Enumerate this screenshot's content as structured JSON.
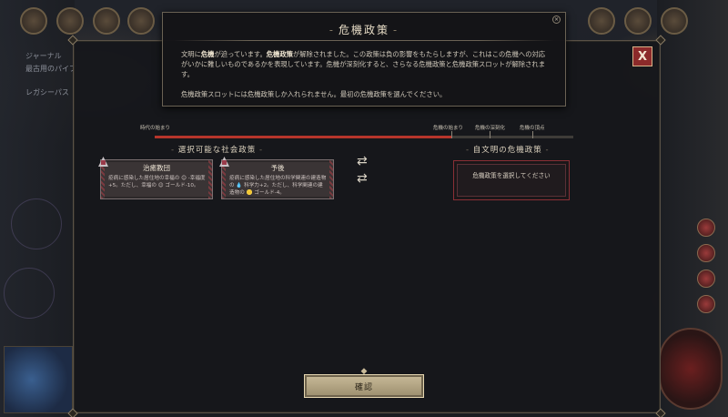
{
  "header": {
    "title": "危機政策",
    "body_line1_parts": [
      "文明に",
      "危機",
      "が迫っています。",
      "危機政策",
      "が解除されました。この政策は負の影響をもたらしますが、これはこの危機への対応がいかに難しいものであるかを表現しています。危機が深刻化すると、さらなる危機政策と危機政策スロットが解除されます。"
    ],
    "body_line2": "危機政策スロットには危機政策しか入れられません。最初の危機政策を選んでください。"
  },
  "timeline": {
    "start_label": "時代の始まり",
    "crisis_start_label": "危機の始まり",
    "crisis_deepening_label": "危機の深刻化",
    "crisis_peak_label": "危機の頂点",
    "progress_fraction": 0.71
  },
  "available": {
    "title": "選択可能な社会政策",
    "cards": [
      {
        "title": "治癒教団",
        "desc": "疫病に感染した居住地の幸福の 😊 -幸福度+5。ただし、幸福の 😊 ゴールド-10。"
      },
      {
        "title": "予後",
        "desc": "疫病に感染した居住地の科学関連の建造物の 💧 科学力+2。ただし、科学関連の建造物の 🪙 ゴールド-4。"
      }
    ]
  },
  "own": {
    "title": "自文明の危機政策",
    "slot_text": "危機政策を選択してください"
  },
  "confirm_label": "確認",
  "close_label": "X",
  "background": {
    "city_name": "ジャーナル",
    "line1": "最古用のパイプ",
    "line2": "レガシーパス"
  },
  "colors": {
    "accent_red": "#b6352b",
    "panel_bg": "#16171b",
    "confirm_gold": "#c9bb99"
  }
}
